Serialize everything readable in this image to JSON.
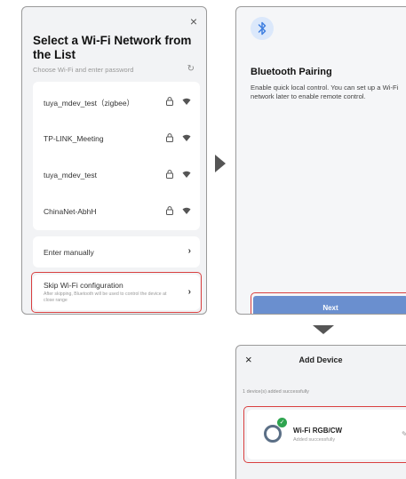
{
  "wifi_screen": {
    "close_glyph": "×",
    "title": "Select a Wi-Fi Network from the List",
    "subtitle": "Choose Wi-Fi and enter password",
    "refresh_glyph": "↻",
    "networks": [
      {
        "ssid": "tuya_mdev_test（zigbee）",
        "icons": [
          "lock-icon",
          "wifi-icon"
        ]
      },
      {
        "ssid": "TP-LINK_Meeting",
        "icons": [
          "lock-icon",
          "wifi-icon"
        ]
      },
      {
        "ssid": "tuya_mdev_test",
        "icons": [
          "lock-icon",
          "wifi-icon"
        ]
      },
      {
        "ssid": "ChinaNet-AbhH",
        "icons": [
          "lock-icon",
          "wifi-icon"
        ]
      }
    ],
    "enter_manually": "Enter manually",
    "skip_label": "Skip Wi-Fi configuration",
    "skip_note": "After skipping, Bluetooth will be used to control the device at close range",
    "chevron_glyph": "›",
    "highlight_color": "#d94040"
  },
  "bluetooth_screen": {
    "icon": "bluetooth-icon",
    "title": "Bluetooth Pairing",
    "description": "Enable quick local control. You can set up a Wi-Fi network later to enable remote control.",
    "next_label": "Next",
    "button_color": "#6a8fcf"
  },
  "add_device_screen": {
    "close_glyph": "×",
    "title": "Add Device",
    "added_count": "1 device(s) added successfully",
    "device_name": "Wi-Fi RGB/CW",
    "device_status": "Added successfully",
    "check_glyph": "✓",
    "edit_glyph": "✎",
    "success_color": "#2ea44f"
  }
}
